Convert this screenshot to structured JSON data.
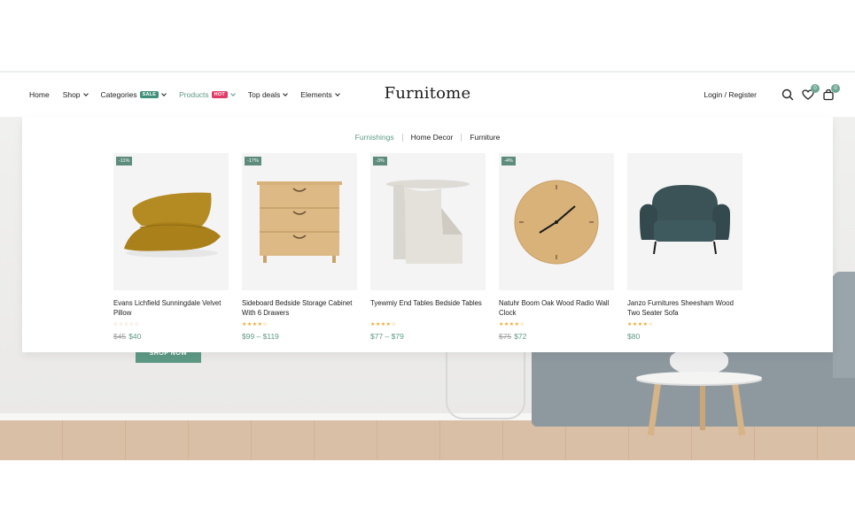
{
  "header": {
    "nav": [
      {
        "label": "Home",
        "chevron": false
      },
      {
        "label": "Shop",
        "chevron": true
      },
      {
        "label": "Categories",
        "chevron": true,
        "badge": "SALE",
        "badge_color": "#3f8f7a"
      },
      {
        "label": "Products",
        "chevron": true,
        "badge": "HOT",
        "badge_color": "#e03b67",
        "active": true
      },
      {
        "label": "Top deals",
        "chevron": true
      },
      {
        "label": "Elements",
        "chevron": true
      }
    ],
    "logo": "Furnitome",
    "login_label": "Login / Register",
    "wishlist_count": "0",
    "cart_count": "0"
  },
  "mega_menu": {
    "tabs": [
      "Furnishings",
      "Home Decor",
      "Furniture"
    ],
    "active_tab": "Furnishings",
    "products": [
      {
        "discount": "-11%",
        "name": "Evans Lichfield Sunningdale Velvet Pillow",
        "old_price": "$45",
        "price": "$40",
        "rating": 0
      },
      {
        "discount": "-17%",
        "name": "Sideboard Bedside Storage Cabinet With 6 Drawers",
        "old_price": "",
        "price": "$99 – $119",
        "rating": 4
      },
      {
        "discount": "-3%",
        "name": "Tyewmiy End Tables Bedside Tables",
        "old_price": "",
        "price": "$77 – $79",
        "rating": 4
      },
      {
        "discount": "-4%",
        "name": "Natuhr Boom Oak Wood Radio Wall Clock",
        "old_price": "$75",
        "price": "$72",
        "rating": 4
      },
      {
        "discount": "",
        "name": "Janzo Furnitures Sheesham Wood Two Seater Sofa",
        "old_price": "",
        "price": "$80",
        "rating": 4
      }
    ]
  },
  "hero": {
    "cta_label": "SHOP NOW"
  },
  "colors": {
    "accent": "#5e9a86",
    "star": "#f2a92e"
  }
}
